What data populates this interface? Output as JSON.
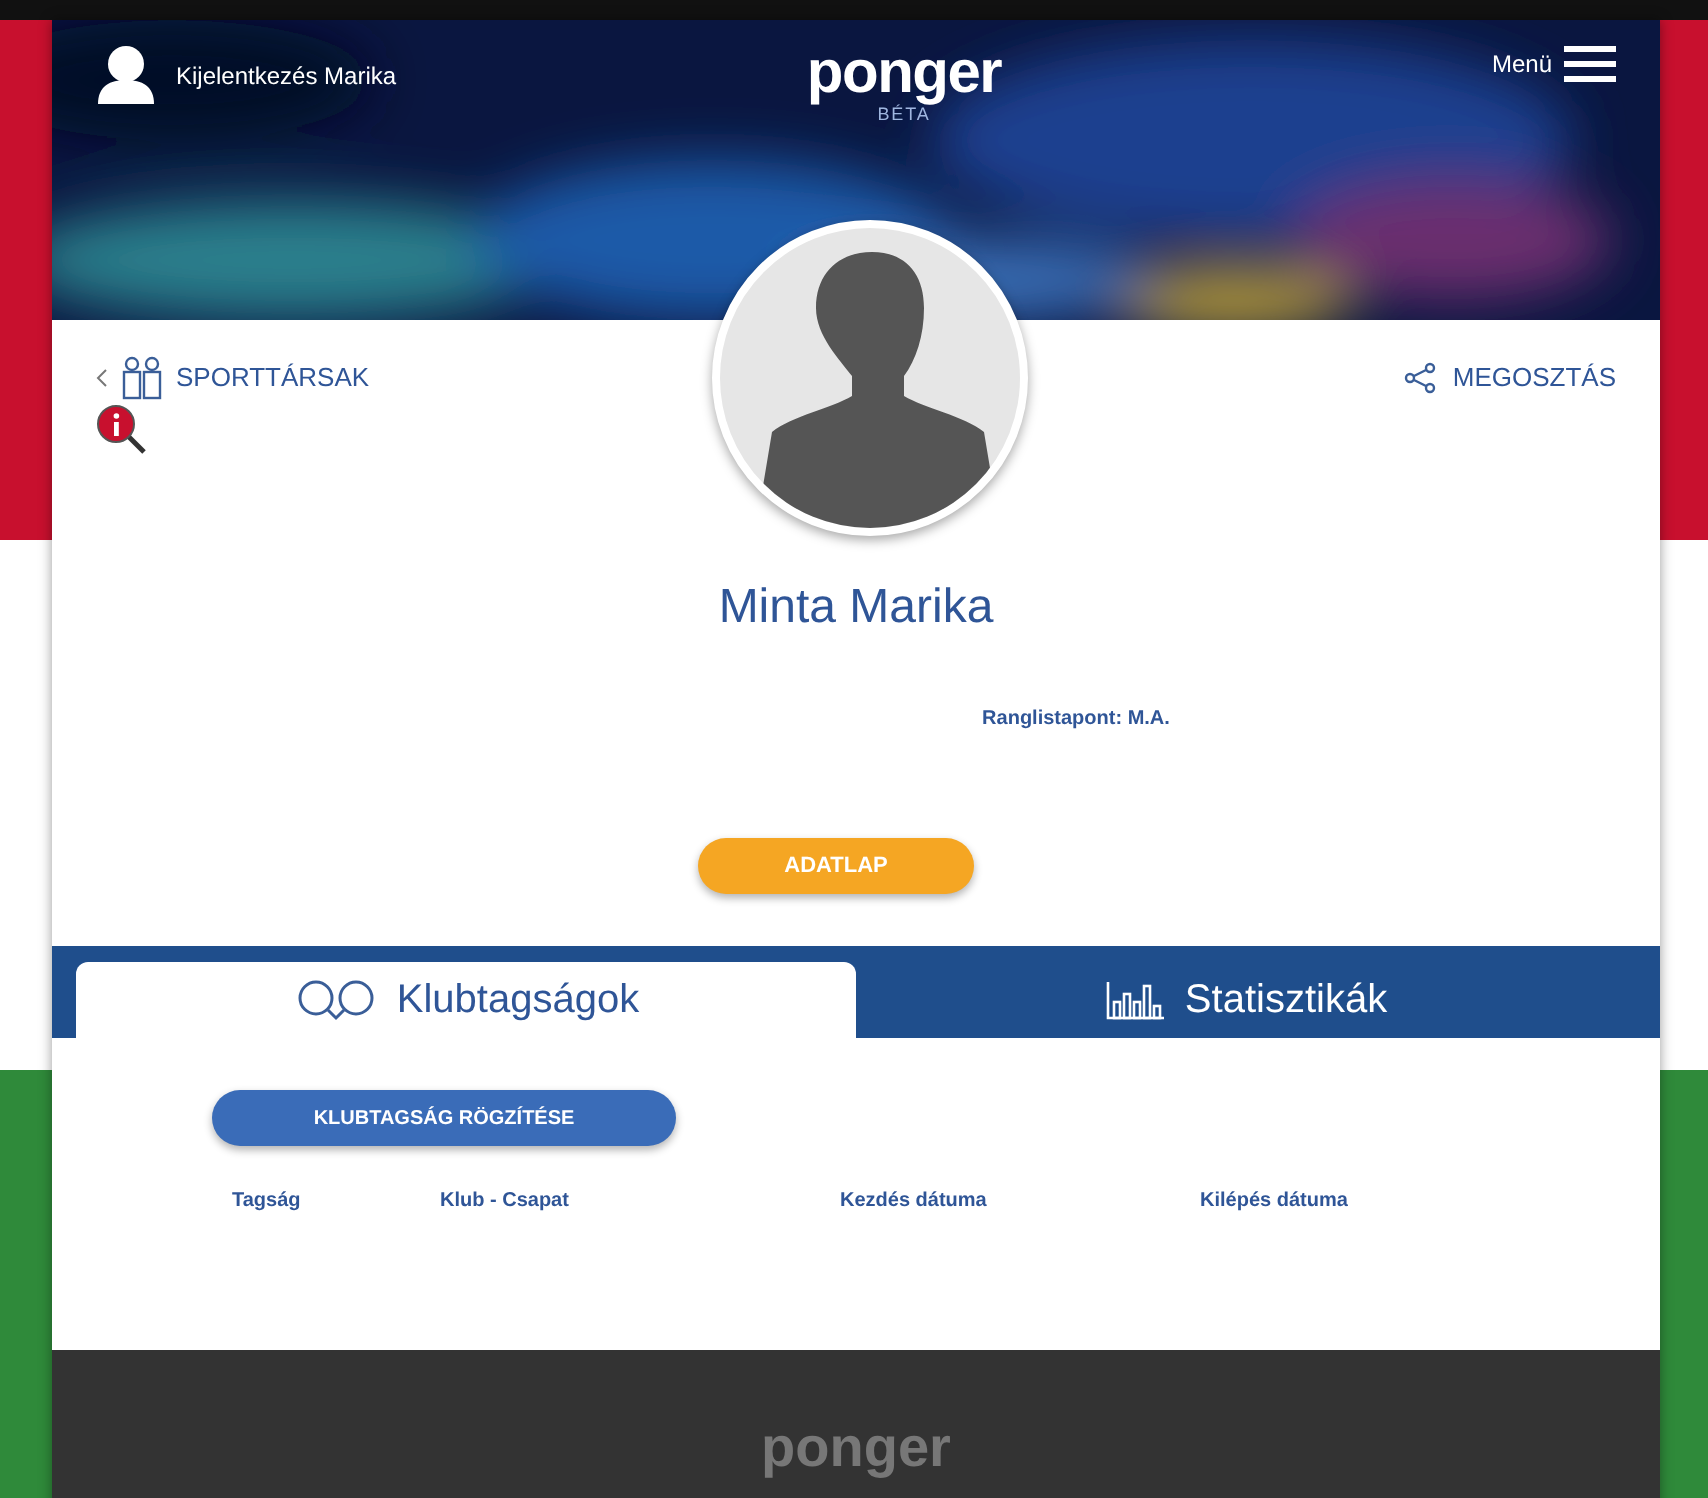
{
  "header": {
    "logout_label": "Kijelentkezés Marika",
    "logo": "ponger",
    "logo_sub": "BÉTA",
    "menu_label": "Menü"
  },
  "profile": {
    "back_link": "SPORTTÁRSAK",
    "share_link": "MEGOSZTÁS",
    "name": "Minta Marika",
    "ranking": "Ranglistapont: M.A.",
    "datasheet_button": "ADATLAP"
  },
  "tabs": [
    {
      "label": "Klubtagságok",
      "kind": "clubs",
      "selected": true
    },
    {
      "label": "Statisztikák",
      "kind": "stats",
      "selected": false
    }
  ],
  "membership": {
    "add_button": "KLUBTAGSÁG RÖGZÍTÉSE",
    "columns": [
      "Tagság",
      "Klub - Csapat",
      "Kezdés dátuma",
      "Kilépés dátuma"
    ]
  },
  "footer": {
    "logo": "ponger"
  }
}
